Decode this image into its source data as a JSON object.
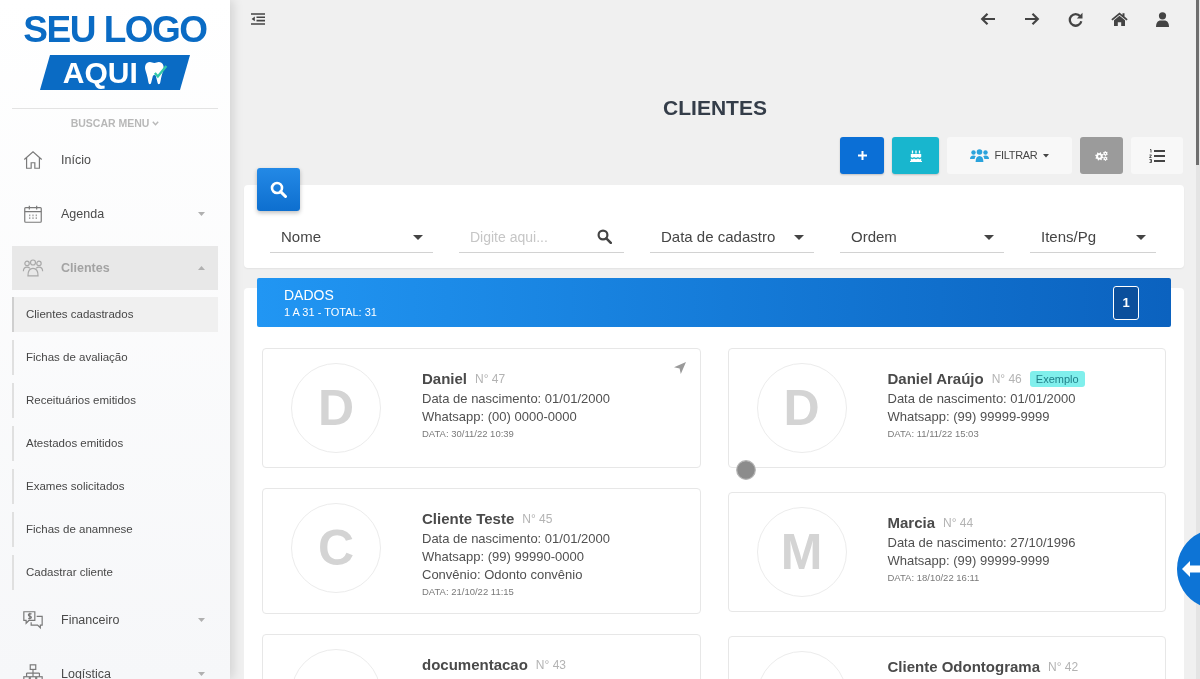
{
  "sidebar": {
    "logo": {
      "top": "SEU LOGO",
      "bottom": "AQUI"
    },
    "menu_search": "BUSCAR MENU",
    "items": [
      {
        "label": "Início",
        "selected": false
      },
      {
        "label": "Agenda",
        "selected": false,
        "expanded": false
      },
      {
        "label": "Clientes",
        "selected": true,
        "expanded": true,
        "children": [
          {
            "label": "Clientes cadastrados",
            "selected": true
          },
          {
            "label": "Fichas de avaliação",
            "selected": false
          },
          {
            "label": "Receituários emitidos",
            "selected": false
          },
          {
            "label": "Atestados emitidos",
            "selected": false
          },
          {
            "label": "Exames solicitados",
            "selected": false
          },
          {
            "label": "Fichas de anamnese",
            "selected": false
          },
          {
            "label": "Cadastrar cliente",
            "selected": false
          }
        ]
      },
      {
        "label": "Financeiro",
        "selected": false,
        "expanded": false
      },
      {
        "label": "Logística",
        "selected": false,
        "expanded": false
      }
    ]
  },
  "page": {
    "title": "CLIENTES"
  },
  "toolbar": {
    "filter_button": "FILTRAR"
  },
  "filters": [
    {
      "kind": "select",
      "value": "Nome"
    },
    {
      "kind": "search",
      "placeholder": "Digite aqui..."
    },
    {
      "kind": "select",
      "value": "Data de cadastro"
    },
    {
      "kind": "select",
      "value": "Ordem"
    },
    {
      "kind": "select",
      "value": "Itens/Pg"
    }
  ],
  "results": {
    "title": "DADOS",
    "summary": "1 A 31 - TOTAL: 31",
    "page": "1"
  },
  "clients": [
    {
      "initial": "D",
      "name": "Daniel",
      "number": "N° 47",
      "details": [
        "Data de nascimento: 01/01/2000",
        "Whatsapp: (00) 0000-0000"
      ],
      "date": "DATA: 30/11/22 10:39",
      "location_arrow": true
    },
    {
      "initial": "D",
      "name": "Daniel Araújo",
      "number": "N° 46",
      "badge": "Exemplo",
      "details": [
        "Data de nascimento: 01/01/2000",
        "Whatsapp: (99) 99999-9999"
      ],
      "date": "DATA: 11/11/22 15:03",
      "location_arrow": false
    },
    {
      "initial": "C",
      "name": "Cliente Teste",
      "number": "N° 45",
      "details": [
        "Data de nascimento: 01/01/2000",
        "Whatsapp: (99) 99990-0000",
        "Convênio: Odonto convênio"
      ],
      "date": "DATA: 21/10/22 11:15",
      "location_arrow": false
    },
    {
      "initial": "M",
      "name": "Marcia",
      "number": "N° 44",
      "details": [
        "Data de nascimento: 27/10/1996",
        "Whatsapp: (99) 99999-9999"
      ],
      "date": "DATA: 18/10/22 16:11",
      "location_arrow": false
    },
    {
      "name": "documentacao",
      "number": "N° 43",
      "location_arrow": false
    },
    {
      "name": "Cliente Odontograma",
      "number": "N° 42",
      "location_arrow": false
    }
  ]
}
